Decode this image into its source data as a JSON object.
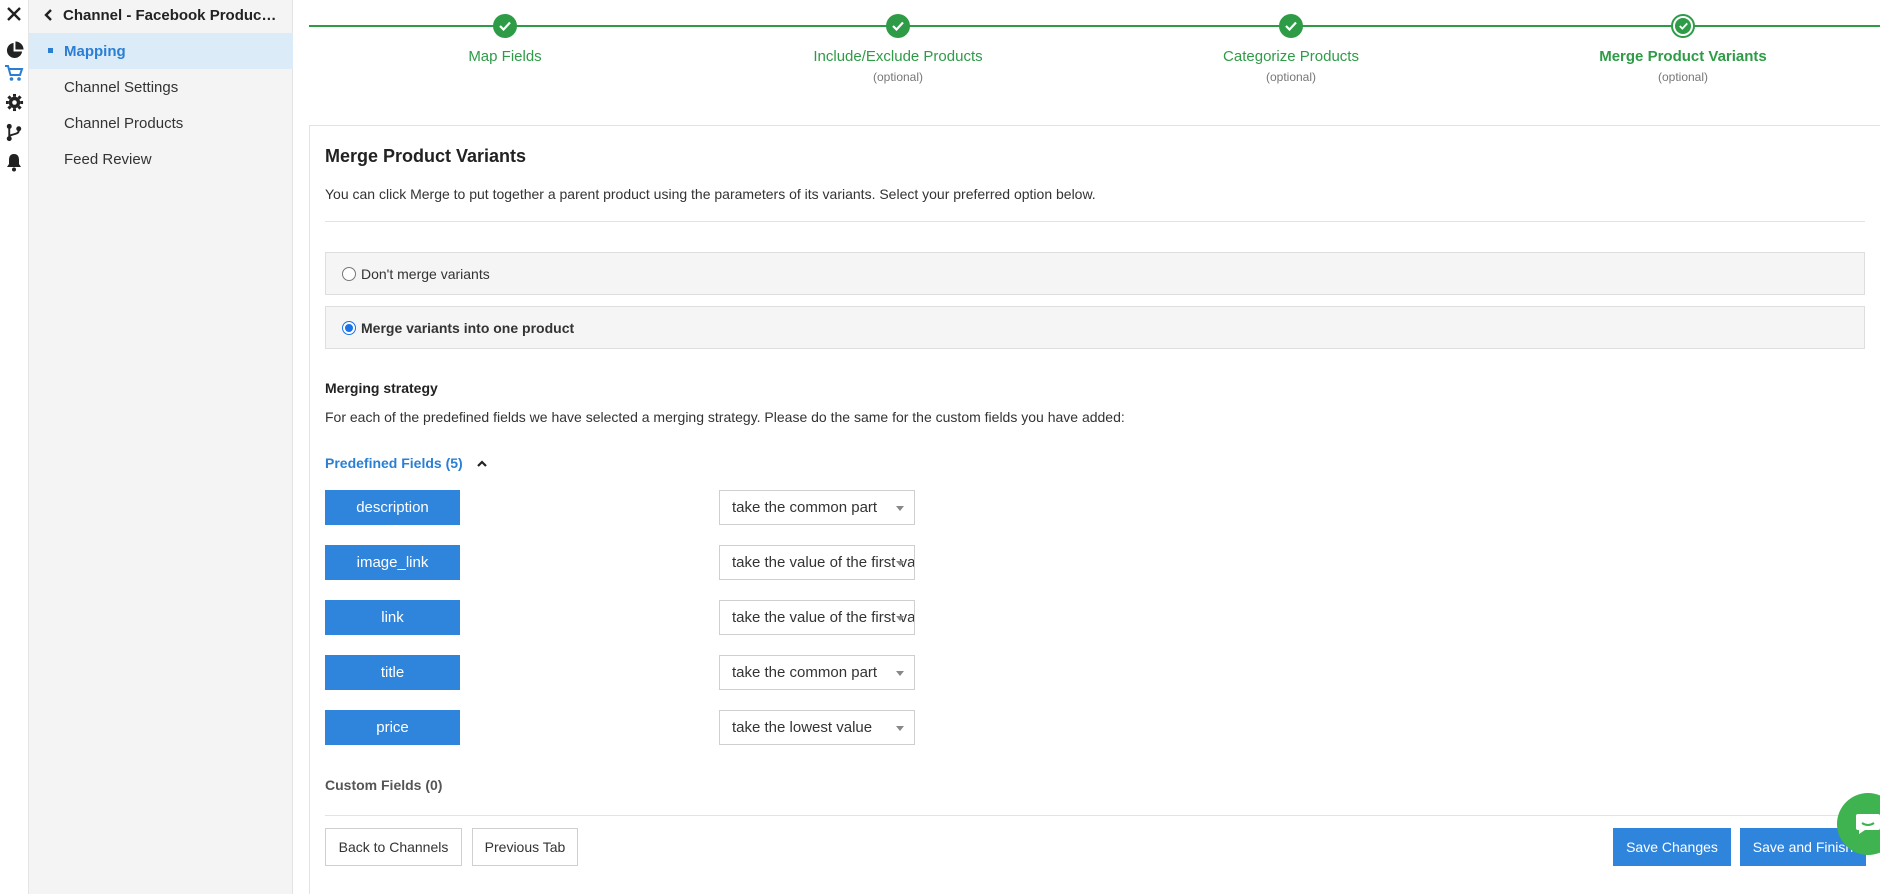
{
  "rail": {
    "icons": [
      "close-icon",
      "pie-chart-icon",
      "cart-icon",
      "gear-icon",
      "branch-icon",
      "bell-icon"
    ],
    "active_color": "#2a7fd4"
  },
  "sidebar": {
    "back_label": "Channel - Facebook Produc…",
    "items": [
      {
        "label": "Mapping",
        "active": true
      },
      {
        "label": "Channel Settings",
        "active": false
      },
      {
        "label": "Channel Products",
        "active": false
      },
      {
        "label": "Feed Review",
        "active": false
      }
    ]
  },
  "stepper": {
    "steps": [
      {
        "label": "Map Fields",
        "sub": "",
        "state": "done"
      },
      {
        "label": "Include/Exclude Products",
        "sub": "(optional)",
        "state": "done"
      },
      {
        "label": "Categorize Products",
        "sub": "(optional)",
        "state": "done"
      },
      {
        "label": "Merge Product Variants",
        "sub": "(optional)",
        "state": "current"
      }
    ],
    "color": "#2e9b47"
  },
  "panel": {
    "title": "Merge Product Variants",
    "intro": "You can click Merge to put together a parent product using the parameters of its variants. Select your preferred option below.",
    "options": [
      {
        "label": "Don't merge variants",
        "selected": false
      },
      {
        "label": "Merge variants into one product",
        "selected": true
      }
    ],
    "merging_strategy_heading": "Merging strategy",
    "merging_strategy_desc": "For each of the predefined fields we have selected a merging strategy. Please do the same for the custom fields you have added:",
    "predefined_label": "Predefined Fields (5)",
    "fields": [
      {
        "name": "description",
        "strategy": "take the common part"
      },
      {
        "name": "image_link",
        "strategy": "take the value of the first variant"
      },
      {
        "name": "link",
        "strategy": "take the value of the first variant"
      },
      {
        "name": "title",
        "strategy": "take the common part"
      },
      {
        "name": "price",
        "strategy": "take the lowest value"
      }
    ],
    "custom_label": "Custom Fields (0)"
  },
  "buttons": {
    "back_to_channels": "Back to Channels",
    "previous_tab": "Previous Tab",
    "save_changes": "Save Changes",
    "save_and_finish": "Save and Finish"
  },
  "colors": {
    "primary": "#2f84dc",
    "success": "#2e9b47",
    "chat": "#3fb34f",
    "badge": "#e0372f"
  }
}
